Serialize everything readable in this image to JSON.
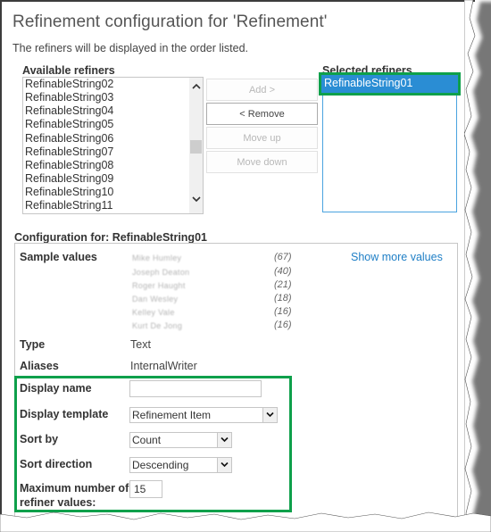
{
  "title": "Refinement configuration for 'Refinement'",
  "subtitle": "The refiners will be displayed in the order listed.",
  "available_refiners": {
    "label": "Available refiners",
    "items": [
      "RefinableString02",
      "RefinableString03",
      "RefinableString04",
      "RefinableString05",
      "RefinableString06",
      "RefinableString07",
      "RefinableString08",
      "RefinableString09",
      "RefinableString10",
      "RefinableString11"
    ]
  },
  "buttons": {
    "add": "Add >",
    "remove": "< Remove",
    "move_up": "Move up",
    "move_down": "Move down"
  },
  "selected_refiners": {
    "label": "Selected refiners",
    "items": [
      "RefinableString01"
    ],
    "selected": "RefinableString01"
  },
  "configuration": {
    "label": "Configuration for: RefinableString01",
    "sample_values_label": "Sample values",
    "sample_values": [
      {
        "name": "Mike Humley",
        "count": "(67)"
      },
      {
        "name": "Joseph Deaton",
        "count": "(40)"
      },
      {
        "name": "Roger Haught",
        "count": "(21)"
      },
      {
        "name": "Dan Wesley",
        "count": "(18)"
      },
      {
        "name": "Kelley Vale",
        "count": "(16)"
      },
      {
        "name": "Kurt De Jong",
        "count": "(16)"
      }
    ],
    "show_more": "Show more values",
    "type_label": "Type",
    "type_value": "Text",
    "aliases_label": "Aliases",
    "aliases_value": "InternalWriter",
    "display_name_label": "Display name",
    "display_name_value": "",
    "display_template_label": "Display template",
    "display_template_value": "Refinement Item",
    "sort_by_label": "Sort by",
    "sort_by_value": "Count",
    "sort_direction_label": "Sort direction",
    "sort_direction_value": "Descending",
    "max_values_label_line1": "Maximum number of",
    "max_values_label_line2": "refiner values:",
    "max_values_value": "15"
  },
  "colors": {
    "selection": "#2a8dd4",
    "highlight_border": "#0ea04b",
    "link": "#1f7fc6"
  }
}
